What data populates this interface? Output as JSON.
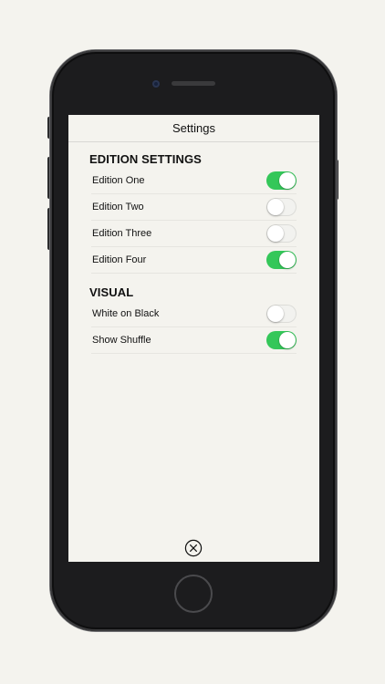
{
  "navbar": {
    "title": "Settings"
  },
  "sections": [
    {
      "title": "EDITION SETTINGS",
      "items": [
        {
          "label": "Edition One",
          "on": true
        },
        {
          "label": "Edition Two",
          "on": false
        },
        {
          "label": "Edition Three",
          "on": false
        },
        {
          "label": "Edition Four",
          "on": true
        }
      ]
    },
    {
      "title": "VISUAL",
      "items": [
        {
          "label": "White on Black",
          "on": false
        },
        {
          "label": "Show Shuffle",
          "on": true
        }
      ]
    }
  ],
  "close_icon": "close-circle-icon",
  "colors": {
    "toggle_on": "#34c759",
    "toggle_off": "#f2f2ef",
    "background": "#f4f3ee"
  }
}
